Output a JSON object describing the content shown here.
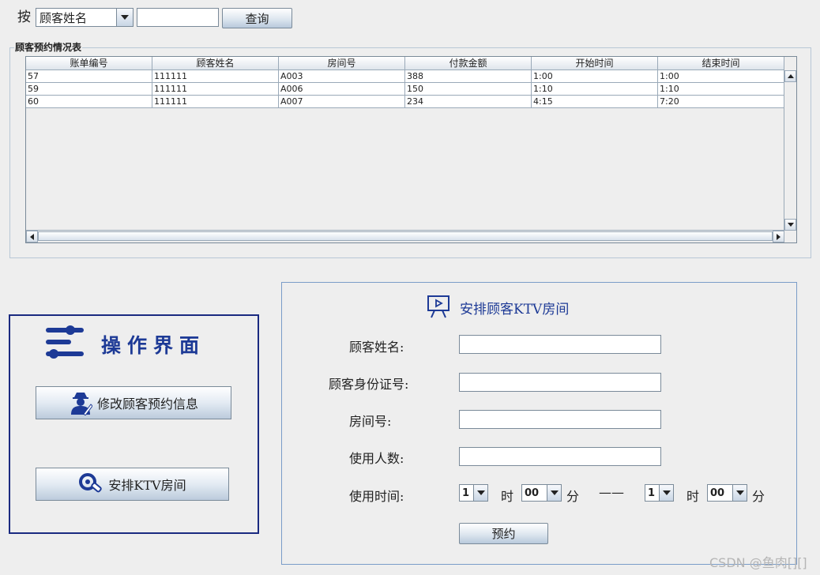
{
  "search": {
    "prefix": "按",
    "field_selected": "顾客姓名",
    "query_value": "",
    "button": "查询"
  },
  "reservations": {
    "title": "顾客预约情况表",
    "columns": [
      "账单编号",
      "顾客姓名",
      "房间号",
      "付款金额",
      "开始时间",
      "结束时间"
    ],
    "rows": [
      [
        "57",
        "111111",
        "A003",
        "388",
        "1:00",
        "1:00"
      ],
      [
        "59",
        "111111",
        "A006",
        "150",
        "1:10",
        "1:10"
      ],
      [
        "60",
        "111111",
        "A007",
        "234",
        "4:15",
        "7:20"
      ]
    ]
  },
  "operations": {
    "title": "操作界面",
    "modify_button": "修改顾客预约信息",
    "arrange_button": "安排KTV房间"
  },
  "arrange_form": {
    "title": "安排顾客KTV房间",
    "name_label": "顾客姓名:",
    "name_value": "",
    "id_label": "顾客身份证号:",
    "id_value": "",
    "room_label": "房间号:",
    "room_value": "",
    "people_label": "使用人数:",
    "people_value": "",
    "time_label": "使用时间:",
    "start_hour": "1",
    "start_minute": "00",
    "end_hour": "1",
    "end_minute": "00",
    "hour_unit": "时",
    "minute_unit": "分",
    "range_separator": "——",
    "submit_button": "预约"
  },
  "watermark": "CSDN @鱼肉[][]",
  "colors": {
    "title_blue": "#1d3a96",
    "ops_border": "#1a2a80",
    "form_border": "#7a9cc8"
  }
}
